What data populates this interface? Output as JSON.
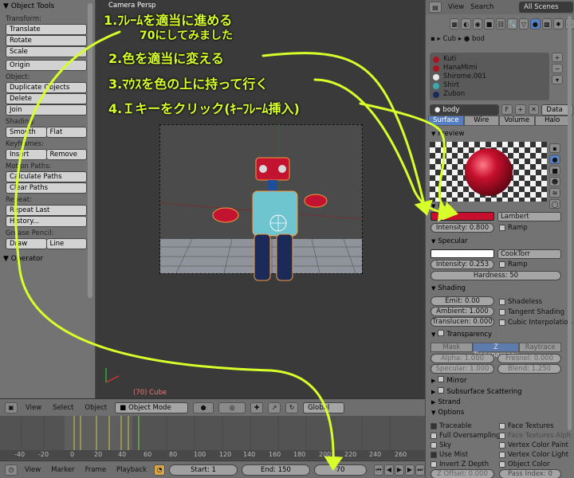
{
  "tools": {
    "title": "Object Tools",
    "transform_label": "Transform:",
    "translate": "Translate",
    "rotate": "Rotate",
    "scale": "Scale",
    "origin": "Origin",
    "object_label": "Object:",
    "duplicate": "Duplicate Objects",
    "delete": "Delete",
    "join": "Join",
    "shading_label": "Shading:",
    "smooth": "Smooth",
    "flat": "Flat",
    "keyframes_label": "Keyframes:",
    "insert": "Insert",
    "remove": "Remove",
    "motion_paths_label": "Motion Paths:",
    "calculate_paths": "Calculate Paths",
    "clear_paths": "Clear Paths",
    "repeat_label": "Repeat:",
    "repeat_last": "Repeat Last",
    "history": "History...",
    "grease_pencil_label": "Grease Pencil:",
    "draw": "Draw",
    "line": "Line",
    "operator": "Operator"
  },
  "viewport": {
    "camera_label": "Camera Persp",
    "frame_label": "(70) Cube"
  },
  "timeline": {
    "header_menu": [
      "View",
      "Select",
      "Object"
    ],
    "mode": "Object Mode",
    "transform_orientation": "Global",
    "ruler_ticks": [
      "-40",
      "-20",
      "0",
      "20",
      "40",
      "60",
      "80",
      "100",
      "120",
      "140",
      "160",
      "180",
      "200",
      "220",
      "240",
      "260"
    ],
    "player_menu": [
      "View",
      "Marker",
      "Frame",
      "Playback"
    ],
    "start_label": "Start: 1",
    "end_label": "End: 150",
    "current_frame": "70"
  },
  "props": {
    "menu": [
      "View",
      "Search"
    ],
    "scenes": "All Scenes",
    "crumb_object": "Cub",
    "crumb_material": "bod",
    "materials": [
      {
        "name": "Kuti",
        "color": "#a8151f"
      },
      {
        "name": "HanaMimi",
        "color": "#a8151f"
      },
      {
        "name": "Shirome.001",
        "color": "#e8e8e8"
      },
      {
        "name": "Shirt",
        "color": "#3aa9ad"
      },
      {
        "name": "Zubon",
        "color": "#1c2a5a"
      }
    ],
    "material_name": "body",
    "data_label": "Data",
    "tabs": [
      "Surface",
      "Wire",
      "Volume",
      "Halo"
    ],
    "active_tab": "Surface",
    "preview_label": "Preview",
    "diffuse_label": "Diff",
    "diffuse_color": "#c8102e",
    "diffuse_shader": "Lambert",
    "diffuse_intensity": "Intensity: 0.800",
    "diffuse_ramp": "Ramp",
    "specular_label": "Specular",
    "specular_shader": "CookTorr",
    "specular_intensity": "Intensity: 0.253",
    "specular_ramp": "Ramp",
    "hardness": "Hardness: 50",
    "shading_label": "Shading",
    "emit": "Emit: 0.00",
    "ambient": "Ambient: 1.000",
    "translucency": "Translucen: 0.000",
    "shadeless": "Shadeless",
    "tangent_shading": "Tangent Shading",
    "cubic_interpolation": "Cubic Interpolation",
    "transparency_label": "Transparency",
    "transp_tabs": [
      "Mask",
      "Z Transparency",
      "Raytrace"
    ],
    "alpha": "Alpha: 1.000",
    "fresnel": "Fresnel: 0.000",
    "specular_t": "Specular: 1.000",
    "blend": "Blend: 1.250",
    "mirror_label": "Mirror",
    "sss_label": "Subsurface Scattering",
    "strand_label": "Strand",
    "options_label": "Options",
    "opt_traceable": "Traceable",
    "opt_full_oversampling": "Full Oversampling",
    "opt_sky": "Sky",
    "opt_use_mist": "Use Mist",
    "opt_invert_z": "Invert Z Depth",
    "opt_z_offset": "Z Offset: 0.000",
    "opt_face_textures": "Face Textures",
    "opt_face_textures_alpha": "Face Textures Alph",
    "opt_vertex_paint": "Vertex Color Paint",
    "opt_vertex_light": "Vertex Color Light",
    "opt_object_color": "Object Color",
    "opt_pass_index": "Pass Index: 0"
  },
  "annotations": {
    "step1": "1.ﾌﾚｰﾑを適当に進める",
    "step1_sub": "70にしてみました",
    "step2": "2.色を適当に変える",
    "step3": "3.ﾏｳｽを色の上に持って行く",
    "step4": "4.Ｉキーをクリック(ｷｰﾌﾚｰﾑ挿入)",
    "color": "#d7ff2a"
  }
}
